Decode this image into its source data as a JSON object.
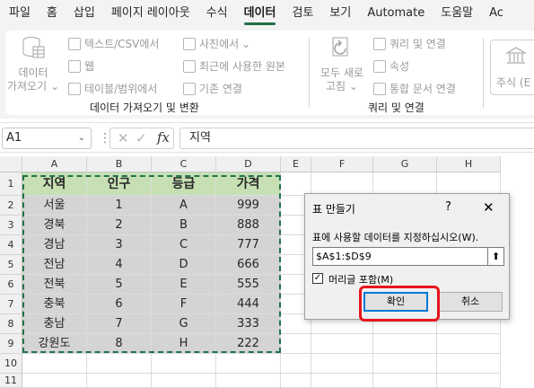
{
  "menu": [
    "파일",
    "홈",
    "삽입",
    "페이지 레이아웃",
    "수식",
    "데이터",
    "검토",
    "보기",
    "Automate",
    "도움말",
    "Ac"
  ],
  "ribbon": {
    "get_data": {
      "line1": "데이터",
      "line2": "가져오기"
    },
    "text_csv": "텍스트/CSV에서",
    "web": "웹",
    "table_range": "테이블/범위에서",
    "from_picture": "사진에서",
    "recent_sources": "최근에 사용한 원본",
    "existing_conn": "기존 연결",
    "group1_label": "데이터 가져오기 및 변환",
    "refresh_all": {
      "line1": "모두 새로",
      "line2": "고침"
    },
    "queries_conn": "쿼리 및 연결",
    "properties": "속성",
    "edit_links": "통합 문서 연결",
    "group2_label": "쿼리 및 연결",
    "stocks": "주식 (E"
  },
  "formula_bar": {
    "name_box": "A1",
    "value": "지역"
  },
  "columns": [
    "A",
    "B",
    "C",
    "D",
    "E",
    "F",
    "G",
    "H"
  ],
  "rows": [
    "1",
    "2",
    "3",
    "4",
    "5",
    "6",
    "7",
    "8",
    "9",
    "10",
    "11"
  ],
  "table": {
    "headers": [
      "지역",
      "인구",
      "등급",
      "가격"
    ],
    "rows": [
      [
        "서울",
        "1",
        "A",
        "999"
      ],
      [
        "경북",
        "2",
        "B",
        "888"
      ],
      [
        "경남",
        "3",
        "C",
        "777"
      ],
      [
        "전남",
        "4",
        "D",
        "666"
      ],
      [
        "전북",
        "5",
        "E",
        "555"
      ],
      [
        "충북",
        "6",
        "F",
        "444"
      ],
      [
        "충남",
        "7",
        "G",
        "333"
      ],
      [
        "강원도",
        "8",
        "H",
        "222"
      ]
    ]
  },
  "dialog": {
    "title": "표 만들기",
    "help": "?",
    "close": "✕",
    "prompt": "표에 사용할 데이터를 지정하십시오(W).",
    "range": "$A$1:$D$9",
    "has_headers_label": "머리글 포함(M)",
    "ok_label": "확인",
    "cancel_label": "취소"
  },
  "colors": {
    "accent": "#217346",
    "header_fill": "#c6e0b4",
    "highlight": "#e8141c",
    "selection": "#d4d4d4"
  }
}
